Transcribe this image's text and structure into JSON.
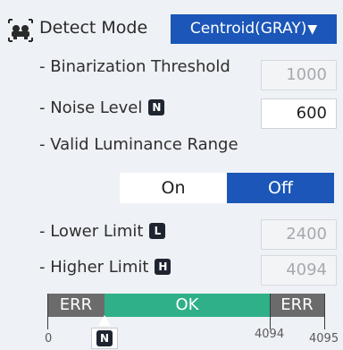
{
  "header": {
    "icon": "detect-mode-icon",
    "label": "Detect Mode",
    "mode_value": "Centroid(GRAY)",
    "caret": "▼"
  },
  "binarization": {
    "label": "- Binarization Threshold",
    "value": "1000"
  },
  "noise": {
    "label": "- Noise Level",
    "badge": "N",
    "value": "600"
  },
  "luminance": {
    "label": "- Valid Luminance Range",
    "on_label": "On",
    "off_label": "Off",
    "selected": "Off"
  },
  "lower": {
    "label": "- Lower Limit",
    "badge": "L",
    "value": "2400"
  },
  "higher": {
    "label": "- Higher Limit",
    "badge": "H",
    "value": "4094"
  },
  "range_bar": {
    "left_label": "ERR",
    "middle_label": "OK",
    "right_label": "ERR",
    "scale": [
      "0",
      "4094",
      "4095"
    ],
    "pointer_badge": "N"
  },
  "colors": {
    "accent": "#1b56b8",
    "ok": "#2fb088",
    "err": "#6b6b6b",
    "background": "#eef1f5"
  }
}
